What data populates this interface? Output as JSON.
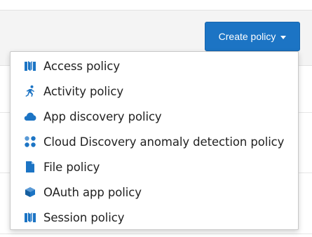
{
  "toolbar": {
    "create_label": "Create policy",
    "accent_color": "#1c74c4"
  },
  "menu": {
    "items": [
      {
        "label": "Access policy",
        "icon": "access-policy-icon"
      },
      {
        "label": "Activity policy",
        "icon": "activity-policy-icon"
      },
      {
        "label": "App discovery policy",
        "icon": "cloud-icon"
      },
      {
        "label": "Cloud Discovery anomaly detection policy",
        "icon": "anomaly-detection-icon"
      },
      {
        "label": "File policy",
        "icon": "file-icon"
      },
      {
        "label": "OAuth app policy",
        "icon": "oauth-app-icon"
      },
      {
        "label": "Session policy",
        "icon": "session-policy-icon"
      }
    ],
    "icon_color": "#1c74c4"
  }
}
